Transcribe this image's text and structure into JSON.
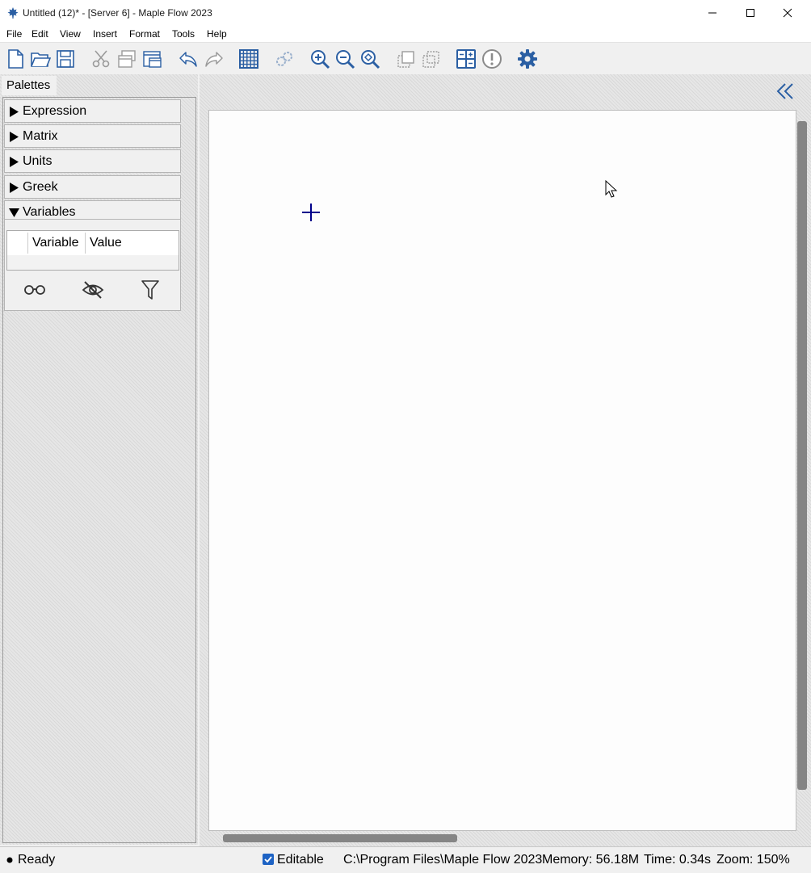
{
  "window": {
    "title": "Untitled (12)* - [Server 6] - Maple Flow 2023",
    "icon": "maple-leaf-icon",
    "controls": [
      "minimize-icon",
      "maximize-icon",
      "close-icon"
    ]
  },
  "menu": {
    "items": [
      "File",
      "Edit",
      "View",
      "Insert",
      "Format",
      "Tools",
      "Help"
    ]
  },
  "toolbar": {
    "icons": [
      "new-document-icon",
      "open-folder-icon",
      "save-icon",
      "cut-icon",
      "copy-icon",
      "paste-icon",
      "undo-icon",
      "redo-icon",
      "grid-icon",
      "link-icon",
      "zoom-in-icon",
      "zoom-out-icon",
      "zoom-fit-icon",
      "group-icon",
      "ungroup-icon",
      "calculator-icon",
      "warning-icon",
      "settings-icon"
    ],
    "accent_color": "#2b5fa3"
  },
  "palettes": {
    "tab_label": "Palettes",
    "sections": [
      {
        "label": "Expression",
        "expanded": false
      },
      {
        "label": "Matrix",
        "expanded": false
      },
      {
        "label": "Units",
        "expanded": false
      },
      {
        "label": "Greek",
        "expanded": false
      },
      {
        "label": "Variables",
        "expanded": true
      }
    ],
    "variables": {
      "columns": [
        "Variable",
        "Value"
      ],
      "buttons": [
        "glasses-icon",
        "eye-slash-icon",
        "filter-icon"
      ]
    }
  },
  "document": {
    "collapse_icon": "double-chevron-left-icon",
    "cursor_icon": "crosshair-icon",
    "cursor_color": "#00008b"
  },
  "status": {
    "ready": "Ready",
    "editable_label": "Editable",
    "editable_checked": true,
    "path": "C:\\Program Files\\Maple Flow 2023",
    "memory": "Memory: 56.18M",
    "time": "Time: 0.34s",
    "zoom": "Zoom: 150%"
  }
}
